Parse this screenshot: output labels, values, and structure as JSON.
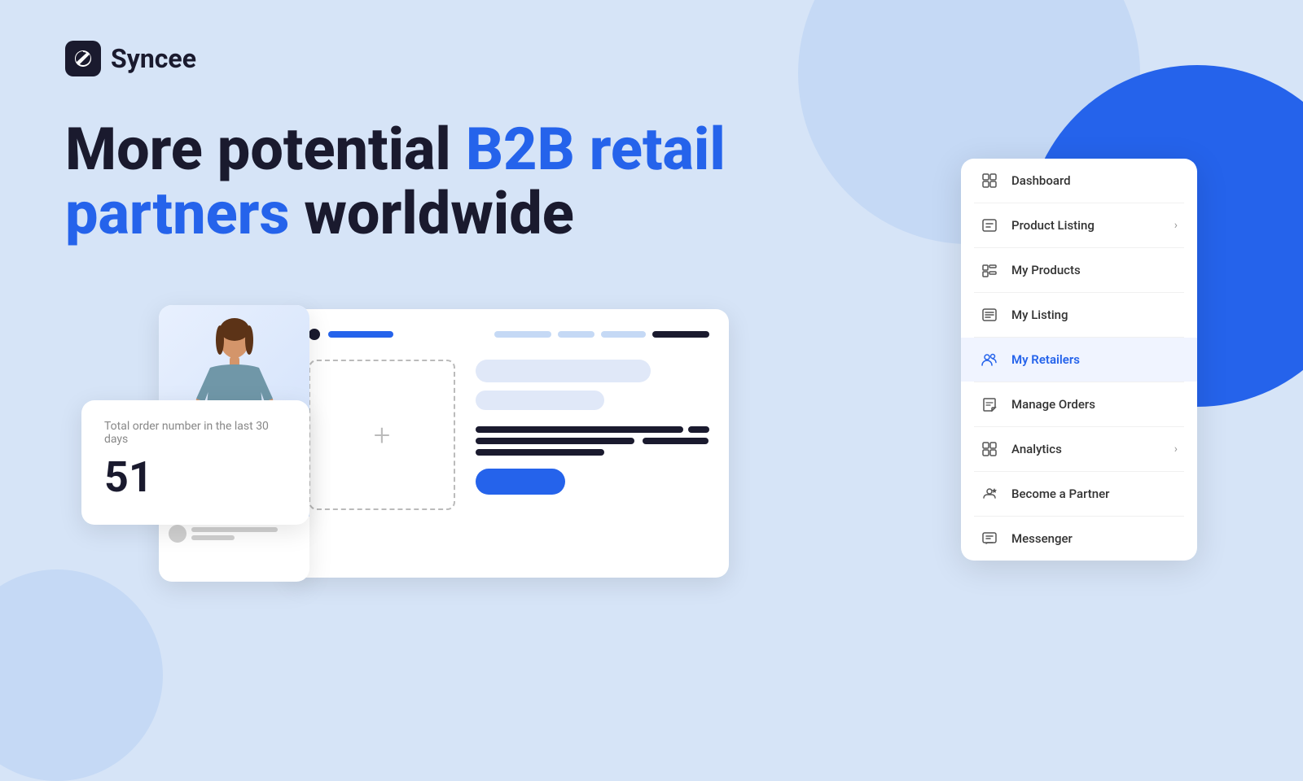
{
  "app": {
    "name": "Syncee"
  },
  "hero": {
    "line1_normal": "More potential ",
    "line1_highlight": "B2B retail",
    "line2_highlight": "partners",
    "line2_normal": " worldwide"
  },
  "order_card": {
    "label": "Total order number in the last 30 days",
    "number": "51"
  },
  "sidebar": {
    "items": [
      {
        "id": "dashboard",
        "label": "Dashboard",
        "icon": "dashboard-icon",
        "arrow": false,
        "active": false
      },
      {
        "id": "product-listing",
        "label": "Product Listing",
        "icon": "product-listing-icon",
        "arrow": true,
        "active": false
      },
      {
        "id": "my-products",
        "label": "My Products",
        "icon": "my-products-icon",
        "arrow": false,
        "active": false
      },
      {
        "id": "my-listing",
        "label": "My Listing",
        "icon": "my-listing-icon",
        "arrow": false,
        "active": false
      },
      {
        "id": "my-retailers",
        "label": "My Retailers",
        "icon": "my-retailers-icon",
        "arrow": false,
        "active": true
      },
      {
        "id": "manage-orders",
        "label": "Manage Orders",
        "icon": "manage-orders-icon",
        "arrow": false,
        "active": false
      },
      {
        "id": "analytics",
        "label": "Analytics",
        "icon": "analytics-icon",
        "arrow": true,
        "active": false
      },
      {
        "id": "become-a-partner",
        "label": "Become a Partner",
        "icon": "become-partner-icon",
        "arrow": false,
        "active": false
      },
      {
        "id": "messenger",
        "label": "Messenger",
        "icon": "messenger-icon",
        "arrow": false,
        "active": false
      }
    ]
  },
  "colors": {
    "blue": "#2563eb",
    "dark": "#1a1a2e",
    "bg": "#d6e4f7"
  }
}
